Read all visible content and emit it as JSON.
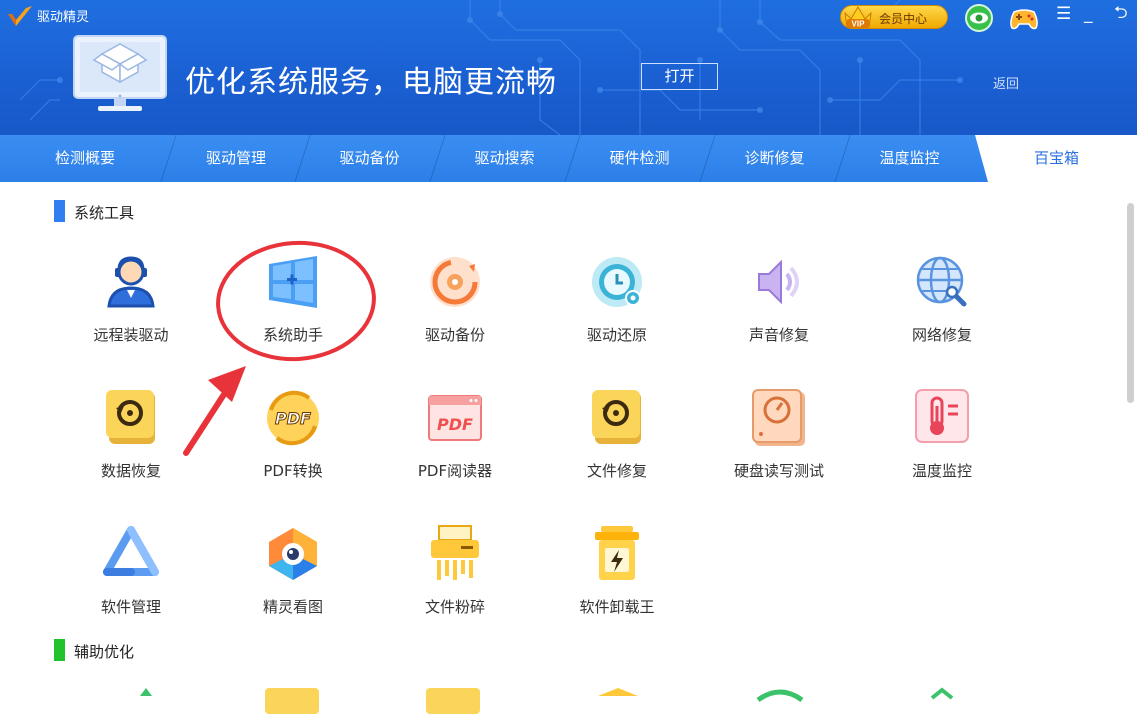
{
  "app": {
    "name": "驱动精灵"
  },
  "titlebar": {
    "vip_label": "会员中心"
  },
  "banner": {
    "title": "优化系统服务，电脑更流畅",
    "open_button": "打开",
    "return_link": "返回"
  },
  "tabs": [
    {
      "label": "检测概要"
    },
    {
      "label": "驱动管理"
    },
    {
      "label": "驱动备份"
    },
    {
      "label": "驱动搜索"
    },
    {
      "label": "硬件检测"
    },
    {
      "label": "诊断修复"
    },
    {
      "label": "温度监控"
    },
    {
      "label": "百宝箱",
      "active": true
    }
  ],
  "sections": [
    {
      "title": "系统工具",
      "color": "#2f7ff0"
    },
    {
      "title": "辅助优化",
      "color": "#22c22a"
    }
  ],
  "tools": [
    {
      "label": "远程装驱动",
      "icon": "remote-support-icon"
    },
    {
      "label": "系统助手",
      "icon": "windows-icon"
    },
    {
      "label": "驱动备份",
      "icon": "driver-backup-icon"
    },
    {
      "label": "驱动还原",
      "icon": "driver-restore-icon"
    },
    {
      "label": "声音修复",
      "icon": "speaker-icon"
    },
    {
      "label": "网络修复",
      "icon": "globe-wrench-icon"
    },
    {
      "label": "数据恢复",
      "icon": "data-recovery-icon"
    },
    {
      "label": "PDF转换",
      "icon": "pdf-convert-icon"
    },
    {
      "label": "PDF阅读器",
      "icon": "pdf-reader-icon"
    },
    {
      "label": "文件修复",
      "icon": "file-repair-icon"
    },
    {
      "label": "硬盘读写测试",
      "icon": "disk-test-icon"
    },
    {
      "label": "温度监控",
      "icon": "thermometer-icon"
    },
    {
      "label": "软件管理",
      "icon": "software-manager-icon"
    },
    {
      "label": "精灵看图",
      "icon": "image-viewer-icon"
    },
    {
      "label": "文件粉碎",
      "icon": "shredder-icon"
    },
    {
      "label": "软件卸载王",
      "icon": "uninstaller-icon"
    }
  ],
  "colors": {
    "header_blue": "#1f6fe0",
    "tab_blue": "#3a8ef2",
    "annotation_red": "#e8333a"
  }
}
